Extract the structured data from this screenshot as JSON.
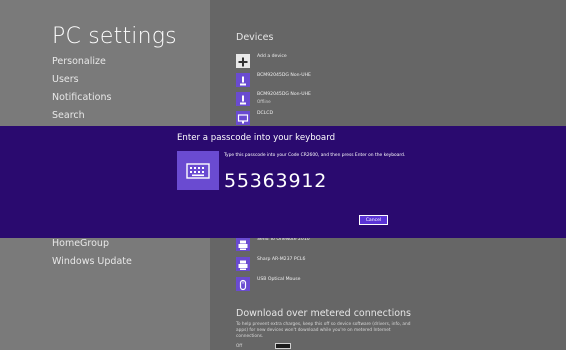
{
  "left_pane": {
    "title": "PC settings",
    "items_top": [
      "Personalize",
      "Users",
      "Notifications",
      "Search"
    ],
    "items_bottom": [
      "HomeGroup",
      "Windows Update"
    ]
  },
  "devices": {
    "title": "Devices",
    "add_device_label": "Add a device",
    "items_top": [
      {
        "name": "BCM92045DG Non-UHE",
        "status": ""
      },
      {
        "name": "BCM92045DG Non-UHE",
        "status": "Offline"
      },
      {
        "name": "DCLCD",
        "status": ""
      }
    ],
    "items_bottom": [
      {
        "name": "Send To OneNote 2010",
        "status": ""
      },
      {
        "name": "Sharp AR-M237 PCL6",
        "status": ""
      },
      {
        "name": "USB Optical Mouse",
        "status": ""
      }
    ]
  },
  "metered": {
    "title": "Download over metered connections",
    "description": "To help prevent extra charges, keep this off so device software (drivers, info, and apps) for new devices won't download while you're on metered Internet connections.",
    "toggle_label": "Off"
  },
  "dialog": {
    "title": "Enter a passcode into your keyboard",
    "instructions": "Type this passcode into your Code CR2600, and then press Enter on the keyboard.",
    "passcode": "55363912",
    "cancel_label": "Cancel"
  },
  "colors": {
    "dialog_background": "#2a0a6f",
    "accent": "#6a4bd1",
    "left_pane_bg": "#7a7a7a",
    "right_pane_bg": "#666666"
  }
}
